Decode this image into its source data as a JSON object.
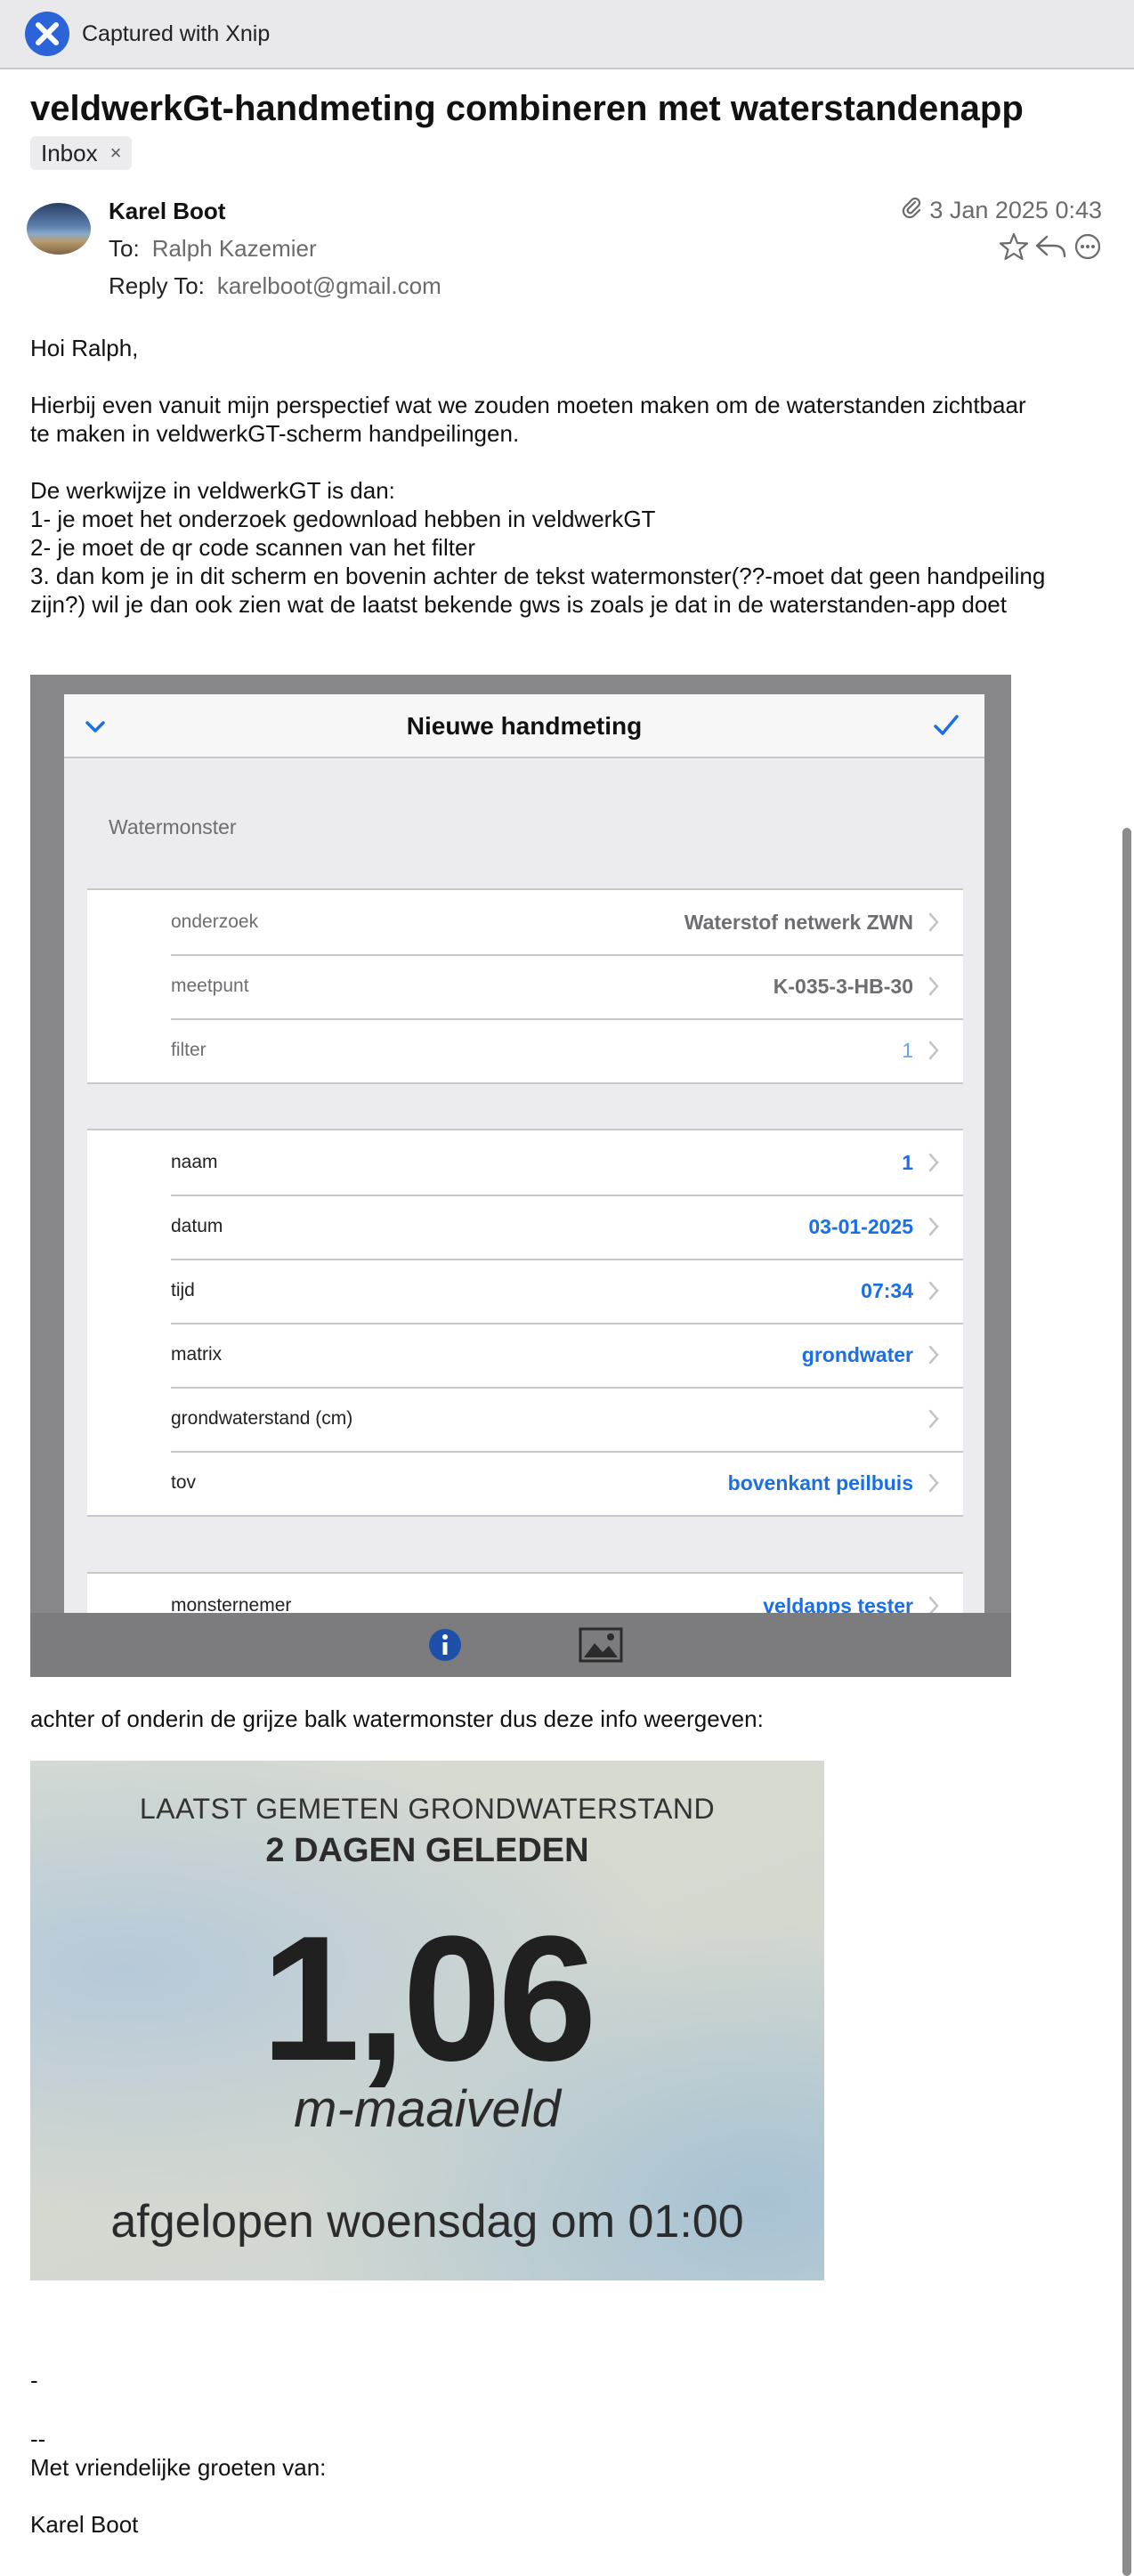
{
  "capture_bar": {
    "label": "Captured with Xnip"
  },
  "mail": {
    "subject": "veldwerkGt-handmeting combineren met waterstandenapp",
    "tag": "Inbox",
    "tag_close": "×",
    "sender": "Karel Boot",
    "to_label": "To:",
    "to_value": "Ralph Kazemier",
    "reply_label": "Reply To:",
    "reply_value": "karelboot@gmail.com",
    "date": "3 Jan 2025 0:43",
    "icons": [
      "paperclip-icon",
      "star-icon",
      "reply-icon",
      "more-icon"
    ]
  },
  "body": {
    "greeting": "Hoi Ralph,",
    "intro_line1": "Hierbij even vanuit mijn perspectief wat we zouden moeten maken om de waterstanden zichtbaar",
    "intro_line2": "te maken in veldwerkGT-scherm handpeilingen.",
    "steps_header": "De werkwijze in veldwerkGT is dan:",
    "step1": "1- je moet het onderzoek gedownload hebben in veldwerkGT",
    "step2": "2- je moet de qr code scannen van het filter",
    "step3_line1": "3. dan kom je in dit scherm en bovenin achter de tekst watermonster(??-moet dat geen handpeiling",
    "step3_line2": "zijn?) wil je dan ook zien wat de laatst bekende gws is zoals je dat in de waterstanden-app doet",
    "after_shot": "achter of onderin de grijze balk watermonster dus deze info weergeven:",
    "dash": "-",
    "sig_sep": "--",
    "closing": "Met vriendelijke groeten van:",
    "signature": "Karel Boot"
  },
  "phone_screen": {
    "nav_title": "Nieuwe handmeting",
    "section_label": "Watermonster",
    "group1": [
      {
        "label": "onderzoek",
        "value": "Waterstof netwerk ZWN",
        "style": "muted"
      },
      {
        "label": "meetpunt",
        "value": "K-035-3-HB-30",
        "style": "muted"
      },
      {
        "label": "filter",
        "value": "1",
        "style": "light"
      }
    ],
    "group2": [
      {
        "label": "naam",
        "value": "1"
      },
      {
        "label": "datum",
        "value": "03-01-2025"
      },
      {
        "label": "tijd",
        "value": "07:34"
      },
      {
        "label": "matrix",
        "value": "grondwater"
      },
      {
        "label": "grondwaterstand (cm)",
        "value": ""
      },
      {
        "label": "tov",
        "value": "bovenkant peilbuis"
      }
    ],
    "group3": [
      {
        "label": "monsternemer",
        "value": "veldapps tester"
      }
    ],
    "toolbar_icons": [
      "info-icon",
      "image-icon"
    ],
    "accent_color": "#1a6fe6"
  },
  "waterstand_card": {
    "line1": "LAATST GEMETEN GRONDWATERSTAND",
    "line2": "2 DAGEN GELEDEN",
    "value": "1,06",
    "unit": "m-maaiveld",
    "when": "afgelopen woensdag om 01:00"
  }
}
